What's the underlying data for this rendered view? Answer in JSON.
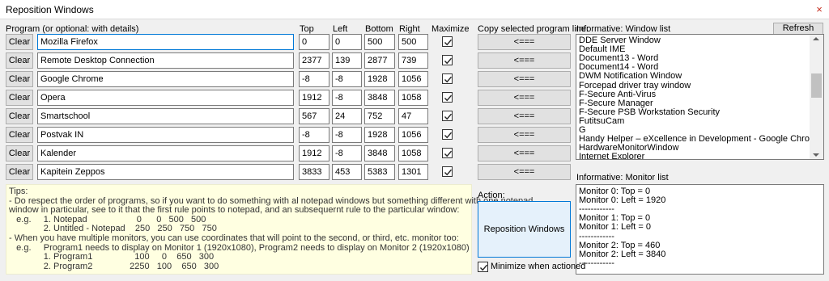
{
  "window": {
    "title": "Reposition Windows",
    "close_label": "×"
  },
  "headers": {
    "program": "Program (or optional: with details)",
    "top": "Top",
    "left": "Left",
    "bottom": "Bottom",
    "right": "Right",
    "maximize": "Maximize",
    "copy": "Copy selected program line:",
    "window_list": "Informative: Window list",
    "monitor_list": "Informative: Monitor list",
    "action": "Action:"
  },
  "rows": [
    {
      "clear": "Clear",
      "program": "Mozilla Firefox",
      "top": "0",
      "left": "0",
      "bottom": "500",
      "right": "500",
      "maximize": true,
      "copy": "<===",
      "focused": true
    },
    {
      "clear": "Clear",
      "program": "Remote Desktop Connection",
      "top": "2377",
      "left": "139",
      "bottom": "2877",
      "right": "739",
      "maximize": true,
      "copy": "<==="
    },
    {
      "clear": "Clear",
      "program": "Google Chrome",
      "top": "-8",
      "left": "-8",
      "bottom": "1928",
      "right": "1056",
      "maximize": true,
      "copy": "<==="
    },
    {
      "clear": "Clear",
      "program": "Opera",
      "top": "1912",
      "left": "-8",
      "bottom": "3848",
      "right": "1058",
      "maximize": true,
      "copy": "<==="
    },
    {
      "clear": "Clear",
      "program": "Smartschool",
      "top": "567",
      "left": "24",
      "bottom": "752",
      "right": "47",
      "maximize": true,
      "copy": "<==="
    },
    {
      "clear": "Clear",
      "program": "Postvak IN",
      "top": "-8",
      "left": "-8",
      "bottom": "1928",
      "right": "1056",
      "maximize": true,
      "copy": "<==="
    },
    {
      "clear": "Clear",
      "program": "Kalender",
      "top": "1912",
      "left": "-8",
      "bottom": "3848",
      "right": "1058",
      "maximize": true,
      "copy": "<==="
    },
    {
      "clear": "Clear",
      "program": "Kapitein Zeppos",
      "top": "3833",
      "left": "453",
      "bottom": "5383",
      "right": "1301",
      "maximize": true,
      "copy": "<==="
    }
  ],
  "refresh_label": "Refresh",
  "window_list": [
    "DDE Server Window",
    "Default IME",
    "Document13 - Word",
    "Document14 - Word",
    "DWM Notification Window",
    "Forcepad driver tray window",
    "F-Secure Anti-Virus",
    "F-Secure Manager",
    "F-Secure PSB Workstation Security",
    "FutitsuCam",
    "G",
    "Handy Helper – eXcellence in Development - Google Chrome",
    "HardwareMonitorWindow",
    "Internet Explorer"
  ],
  "monitor_list": [
    "Monitor 0: Top  = 0",
    "Monitor 0: Left = 1920",
    "------------",
    "Monitor 1: Top  = 0",
    "Monitor 1: Left = 0",
    "------------",
    "Monitor 2: Top  = 460",
    "Monitor 2: Left = 3840",
    "------------"
  ],
  "tips": [
    "Tips:",
    "- Do respect the order of programs, so if you want to do something with al notepad windows but something different with one notepad",
    "window in particular, see to it that the first rule points to notepad, and an subsequernt rule to the particular window:",
    "   e.g.     1. Notepad                    0      0   500   500",
    "              2. Untitled - Notepad    250   250   750   750",
    "- When you have multiple monitors, you can use coordinates that will point to the second, or third, etc. monitor too:",
    "   e.g.     Program1 needs to display on Monitor 1 (1920x1080), Program2 needs to display on Monitor 2 (1920x1080)",
    "              1. Program1                 100     0    650   300",
    "              2. Program2               2250   100    650   300"
  ],
  "action_button_label": "Reposition Windows",
  "minimize_label": "Minimize when actioned",
  "minimize_checked": true
}
